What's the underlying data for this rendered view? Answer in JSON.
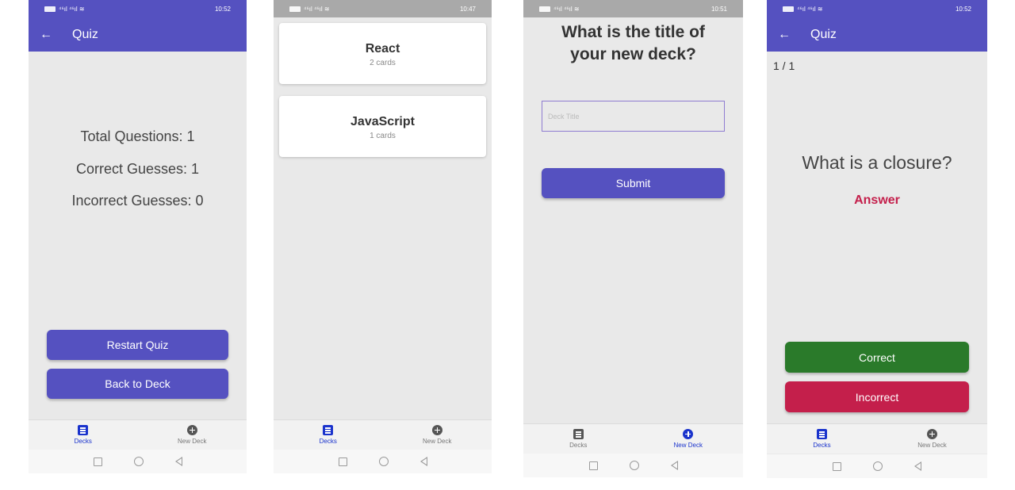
{
  "statusbar": {
    "screen1_time": "10:52",
    "screen2_time": "10:47",
    "screen3_time": "10:51",
    "screen4_time": "10:52"
  },
  "screen1": {
    "header_title": "Quiz",
    "total_questions": "Total Questions: 1",
    "correct_guesses": "Correct Guesses: 1",
    "incorrect_guesses": "Incorrect Guesses: 0",
    "restart_label": "Restart Quiz",
    "back_label": "Back to Deck"
  },
  "screen2": {
    "decks": [
      {
        "title": "React",
        "count": "2 cards"
      },
      {
        "title": "JavaScript",
        "count": "1 cards"
      }
    ]
  },
  "screen3": {
    "question": "What is the title of your new deck?",
    "input_placeholder": "Deck Title",
    "input_value": "",
    "submit_label": "Submit"
  },
  "screen4": {
    "header_title": "Quiz",
    "counter": "1 / 1",
    "question": "What is a closure?",
    "answer_label": "Answer",
    "correct_label": "Correct",
    "incorrect_label": "Incorrect"
  },
  "tabs": {
    "decks_label": "Decks",
    "new_deck_label": "New Deck"
  },
  "colors": {
    "primary": "#5551c0",
    "active_tab": "#1a33cc",
    "correct": "#2a7a2a",
    "incorrect": "#c41f4b"
  },
  "icons": {
    "decks": "list-icon",
    "new_deck": "plus-circle-icon",
    "back": "back-arrow-icon"
  }
}
